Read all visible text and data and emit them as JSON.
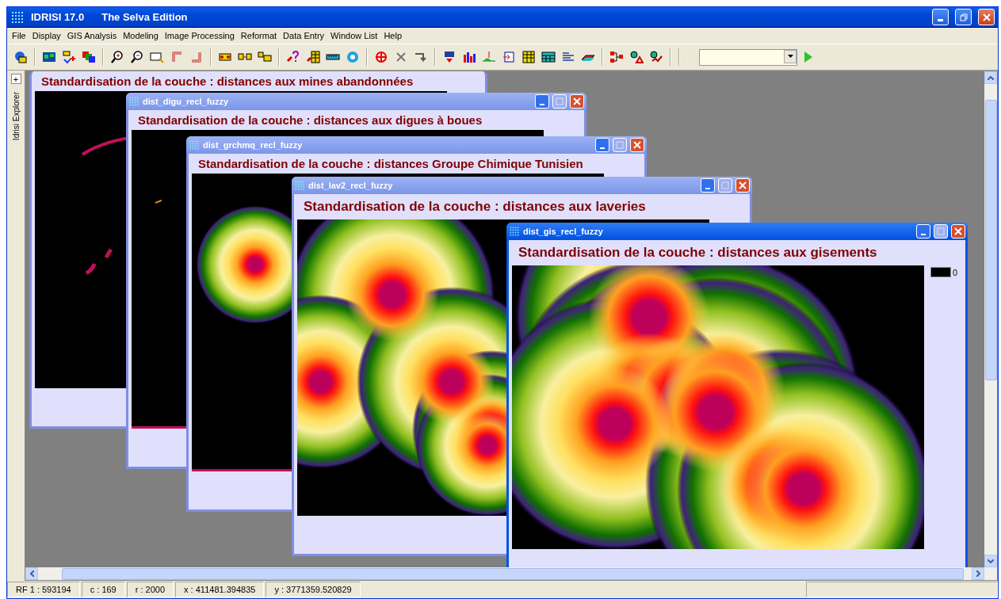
{
  "app": {
    "title": "IDRISI 17.0",
    "edition": "The Selva Edition"
  },
  "menu": [
    "File",
    "Display",
    "GIS Analysis",
    "Modeling",
    "Image Processing",
    "Reformat",
    "Data Entry",
    "Window List",
    "Help"
  ],
  "explorer": {
    "expand": "+",
    "label": "Idrisi Explorer"
  },
  "windows": [
    {
      "heading": "Standardisation de la couche : distances aux mines abandonnées",
      "kind": "curves",
      "selected": false
    },
    {
      "title": "dist_digu_recl_fuzzy",
      "heading": "Standardisation de la couche : distances aux digues à boues",
      "kind": "specks",
      "selected": false
    },
    {
      "title": "dist_grchmq_recl_fuzzy",
      "heading": "Standardisation de la couche : distances Groupe Chimique Tunisien",
      "kind": "ring",
      "selected": false
    },
    {
      "title": "dist_lav2_recl_fuzzy",
      "heading": "Standardisation de la couche : distances aux laveries",
      "kind": "cluster-a",
      "selected": false
    },
    {
      "title": "dist_gis_recl_fuzzy",
      "heading": "Standardisation de la couche : distances aux gisements",
      "kind": "cluster-b",
      "selected": true,
      "legend": "0"
    }
  ],
  "status_bar": [
    "RF 1 : 593194",
    "c : 169",
    "r : 2000",
    "x : 411481.394835",
    "y : 3771359.520829"
  ]
}
